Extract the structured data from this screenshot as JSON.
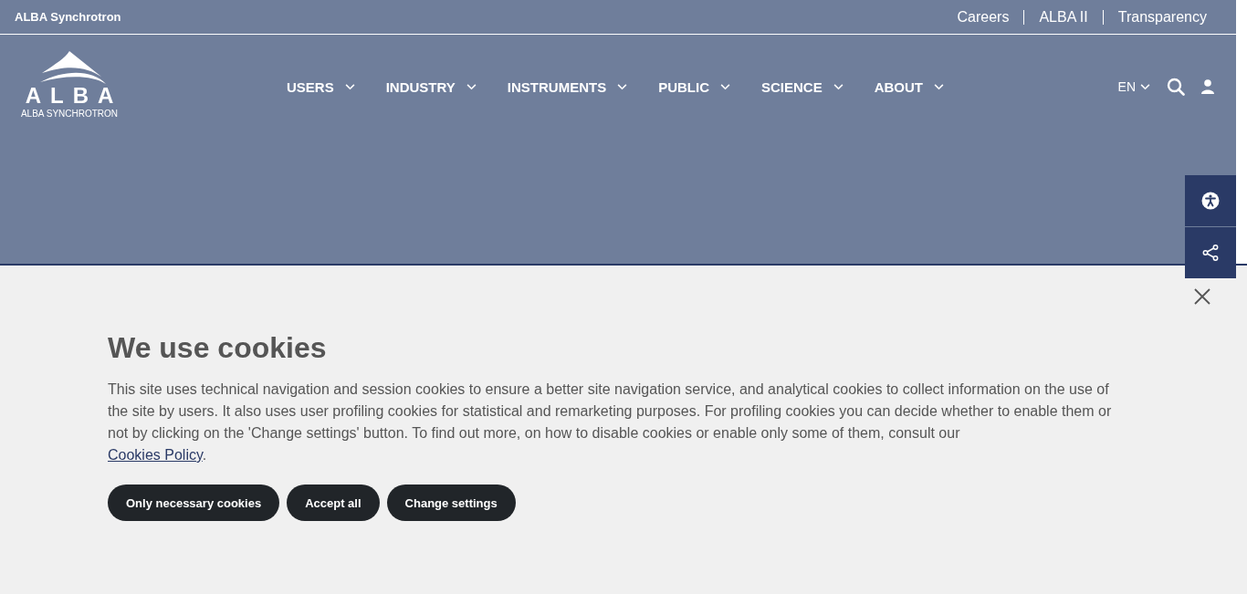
{
  "top_bar": {
    "site_name": "ALBA Synchrotron",
    "links": [
      "Careers",
      "ALBA II",
      "Transparency"
    ]
  },
  "header": {
    "logo": {
      "wordmark": "ALBA",
      "subtitle": "ALBA SYNCHROTRON"
    },
    "nav": [
      {
        "label": "USERS"
      },
      {
        "label": "INDUSTRY"
      },
      {
        "label": "INSTRUMENTS"
      },
      {
        "label": "PUBLIC"
      },
      {
        "label": "SCIENCE"
      },
      {
        "label": "ABOUT"
      }
    ],
    "language": "EN"
  },
  "side_tabs": [
    {
      "kind": "accessibility"
    },
    {
      "kind": "share"
    }
  ],
  "cookie_banner": {
    "title": "We use cookies",
    "text": "This site uses technical navigation and session cookies to ensure a better site navigation service, and analytical cookies to collect information on the use of the site by users. It also uses user profiling cookies for statistical and remarketing purposes. For profiling cookies you can decide whether to enable them or not by clicking on the 'Change settings' button. To find out more, on how to disable cookies or enable only some of them, consult our",
    "link": "Cookies Policy",
    "text_after": ".",
    "buttons": [
      "Only necessary cookies",
      "Accept all",
      "Change settings"
    ]
  }
}
